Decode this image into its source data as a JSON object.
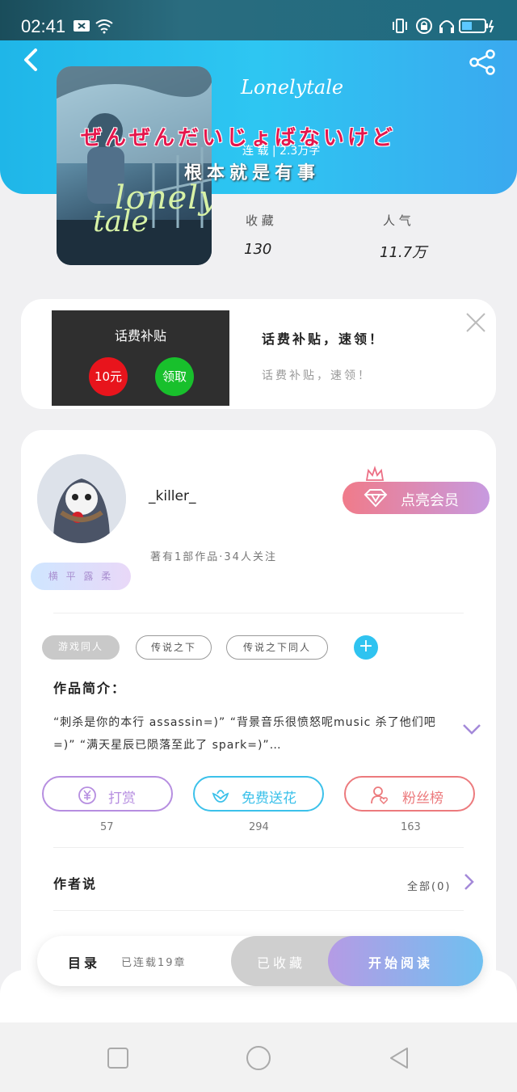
{
  "status_bar": {
    "time": "02:41"
  },
  "book": {
    "title": "Lonelytale",
    "cover_title_1": "lonely",
    "cover_title_2": "tale",
    "overlay_jp": "ぜんぜんだいじょばないけど",
    "status_line": "连 载  |  2.3万字",
    "overlay_cn": "根本就是有事",
    "stats": [
      {
        "label": "收 藏",
        "value": "130"
      },
      {
        "label": "人 气",
        "value": "11.7万"
      }
    ]
  },
  "ad": {
    "image_title": "话费补贴",
    "image_btn_1": "10元",
    "image_btn_2": "领取",
    "title": "话费补贴，速领！",
    "subtitle": "话费补贴，速领！"
  },
  "author": {
    "name": "_killer_",
    "vip_label": "点亮会员",
    "meta": "著有1部作品·34人关注",
    "badge": "横 平 露 柔",
    "tags": [
      "游戏同人",
      "传说之下",
      "传说之下同人"
    ],
    "intro_title": "作品简介：",
    "intro_text": "“刺杀是你的本行 assassin=)” “背景音乐很愤怒呢music 杀了他们吧=)” “满天星辰已陨落至此了 spark=)”…"
  },
  "actions": [
    {
      "label": "打赏",
      "count": "57",
      "color": "#b68ee0"
    },
    {
      "label": "免费送花",
      "count": "294",
      "color": "#3cc1ea"
    },
    {
      "label": "粉丝榜",
      "count": "163",
      "color": "#ec7a7d"
    }
  ],
  "author_says": {
    "title": "作者说",
    "all_label": "全部(0)"
  },
  "bottom_bar": {
    "toc": "目录",
    "chapters": "已连载19章",
    "saved": "已收藏",
    "read": "开始阅读"
  },
  "icons": {
    "back": "back-arrow-icon",
    "share": "share-icon",
    "close": "close-icon",
    "expand": "chevron-down-icon"
  }
}
